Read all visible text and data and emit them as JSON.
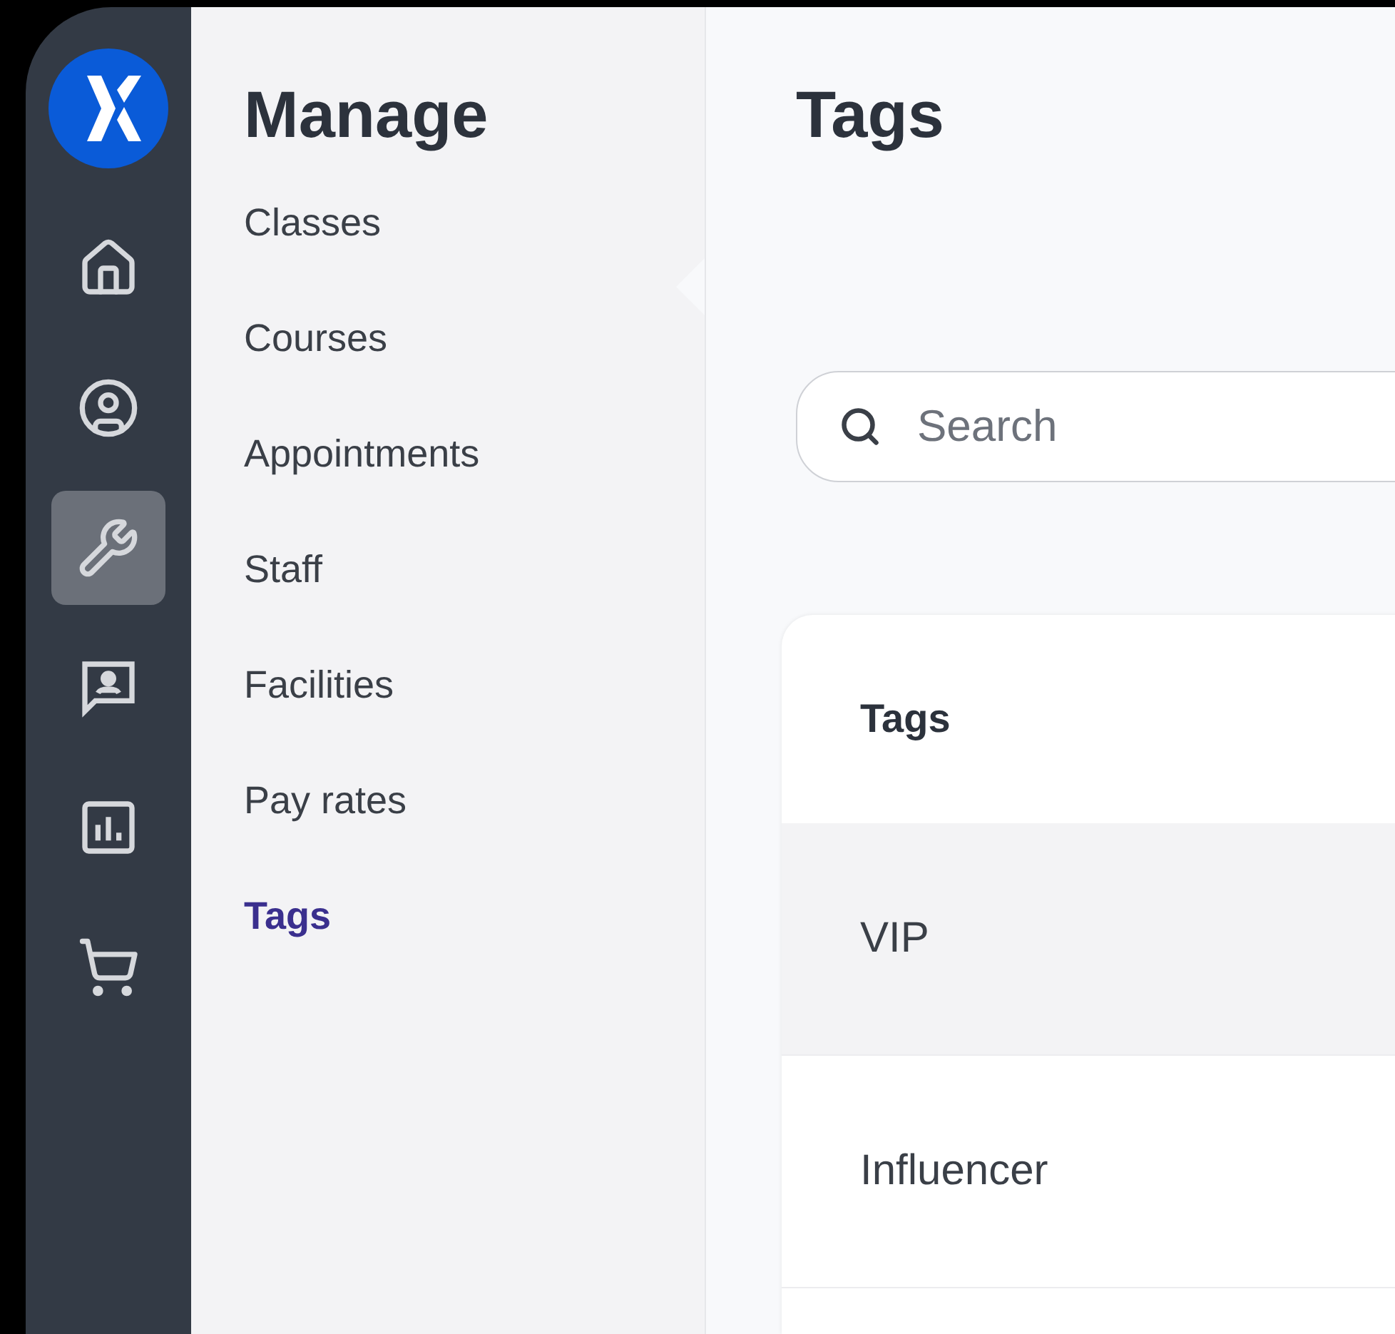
{
  "nav_rail": [
    {
      "selected": false
    },
    {
      "selected": false
    },
    {
      "selected": true
    },
    {
      "selected": false
    },
    {
      "selected": false
    },
    {
      "selected": false
    }
  ],
  "sidebar": {
    "title": "Manage",
    "items": [
      {
        "label": "Classes",
        "selected": false
      },
      {
        "label": "Courses",
        "selected": false
      },
      {
        "label": "Appointments",
        "selected": false
      },
      {
        "label": "Staff",
        "selected": false
      },
      {
        "label": "Facilities",
        "selected": false
      },
      {
        "label": "Pay rates",
        "selected": false
      },
      {
        "label": "Tags",
        "selected": true
      }
    ]
  },
  "main": {
    "title": "Tags",
    "search": {
      "placeholder": "Search"
    },
    "table": {
      "columns": [
        "Tags"
      ],
      "rows": [
        {
          "cells": [
            "VIP"
          ],
          "selected": true
        },
        {
          "cells": [
            "Influencer"
          ],
          "selected": false
        }
      ]
    }
  }
}
